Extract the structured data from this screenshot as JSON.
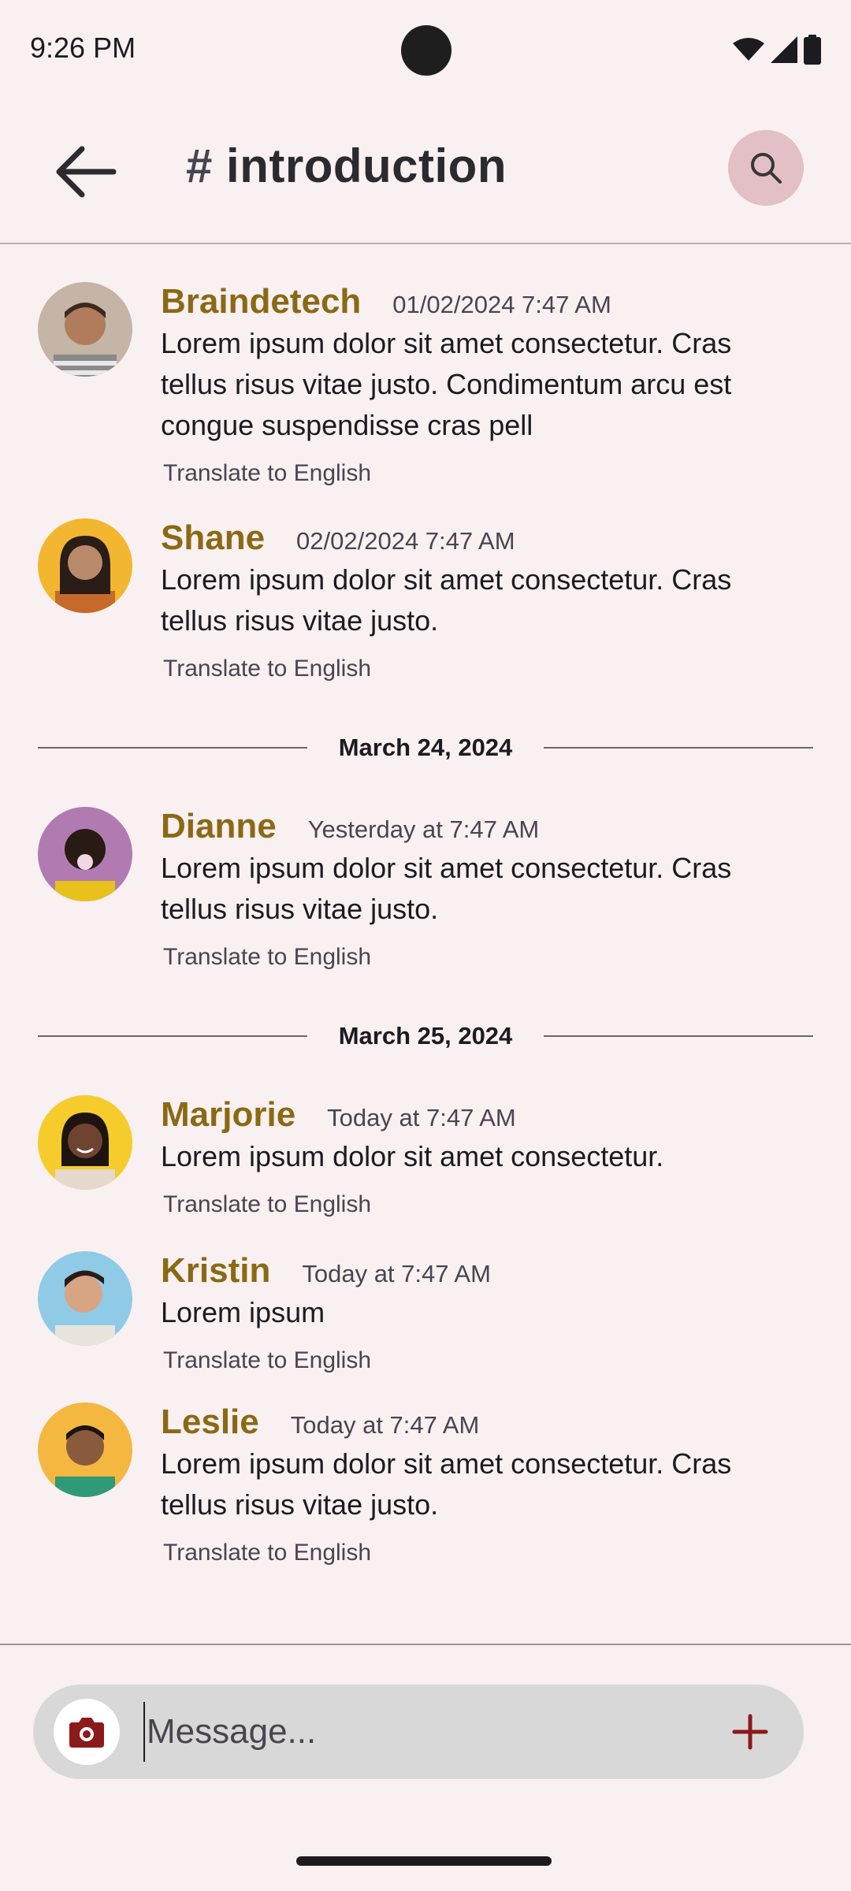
{
  "status_bar": {
    "time": "9:26 PM"
  },
  "header": {
    "hash": "#",
    "channel": "introduction"
  },
  "icons": {
    "back": "arrow-back-icon",
    "search": "search-icon",
    "camera": "camera-icon",
    "add": "plus-icon",
    "wifi": "wifi-icon",
    "signal": "signal-icon",
    "battery": "battery-icon"
  },
  "colors": {
    "background": "#f9f0f1",
    "name_accent": "#8b6914",
    "search_bg": "#e2c0c5",
    "composer_bg": "#d9d8d8",
    "camera_icon": "#8b1a1a",
    "add_icon": "#8b1a1a"
  },
  "messages": [
    {
      "name": "Braindetech",
      "time": "01/02/2024 7:47 AM",
      "text": "Lorem ipsum dolor sit amet consectetur. Cras tellus risus vitae justo. Condimentum arcu est congue suspendisse cras pell",
      "translate": "Translate to English"
    },
    {
      "name": "Shane",
      "time": "02/02/2024 7:47 AM",
      "text": "Lorem ipsum dolor sit amet consectetur. Cras tellus risus vitae justo.",
      "translate": "Translate to English"
    },
    {
      "name": "Dianne",
      "time": "Yesterday at 7:47 AM",
      "text": "Lorem ipsum dolor sit amet consectetur. Cras tellus risus vitae justo.",
      "translate": "Translate to English"
    },
    {
      "name": "Marjorie",
      "time": "Today at 7:47 AM",
      "text": "Lorem ipsum dolor sit amet consectetur.",
      "translate": "Translate to English"
    },
    {
      "name": "Kristin",
      "time": "Today at 7:47 AM",
      "text": "Lorem ipsum",
      "translate": "Translate to English"
    },
    {
      "name": "Leslie",
      "time": "Today at 7:47 AM",
      "text": "Lorem ipsum dolor sit amet consectetur. Cras tellus risus vitae justo.",
      "translate": "Translate to English"
    }
  ],
  "dividers": [
    "March 24, 2024",
    "March 25, 2024"
  ],
  "composer": {
    "placeholder": "Message..."
  }
}
